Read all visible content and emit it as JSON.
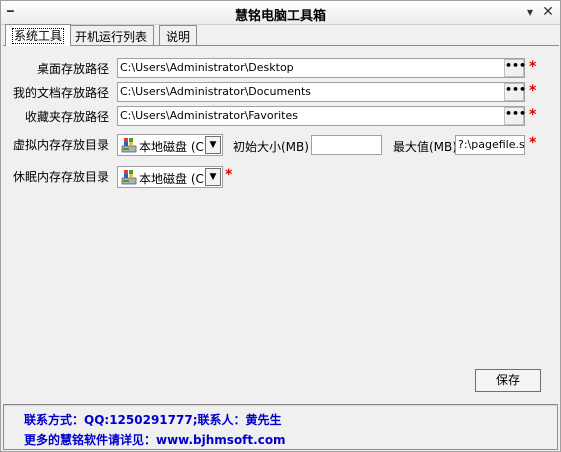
{
  "window": {
    "title": "慧铭电脑工具箱",
    "sys_icon": "minus-glyph-icon",
    "minimize_glyph": "▾",
    "close_glyph": "✕"
  },
  "tabs": [
    {
      "label": "系统工具",
      "active": true
    },
    {
      "label": "开机运行列表",
      "active": false
    },
    {
      "label": "说明",
      "active": false
    }
  ],
  "paths": [
    {
      "label": "桌面存放路径",
      "value": "C:\\Users\\Administrator\\Desktop"
    },
    {
      "label": "我的文档存放路径",
      "value": "C:\\Users\\Administrator\\Documents"
    },
    {
      "label": "收藏夹存放路径",
      "value": "C:\\Users\\Administrator\\Favorites"
    }
  ],
  "browse_label": "•••",
  "required_mark": "*",
  "virtual_memory": {
    "label": "虚拟内存存放目录",
    "drive": "本地磁盘 (C",
    "initial_label": "初始大小(MB)",
    "initial_value": "",
    "max_label": "最大值(MB)",
    "max_value": "?:\\pagefile.sys"
  },
  "hibernate": {
    "label": "休眠内存存放目录",
    "drive": "本地磁盘 (C"
  },
  "save_label": "保存",
  "footer": {
    "contact": "联系方式：QQ:1250291777;联系人：黄先生",
    "more": "更多的慧铭软件请详见：www.bjhmsoft.com"
  },
  "colors": {
    "link_blue": "#0000cc",
    "required_red": "#e00000"
  }
}
